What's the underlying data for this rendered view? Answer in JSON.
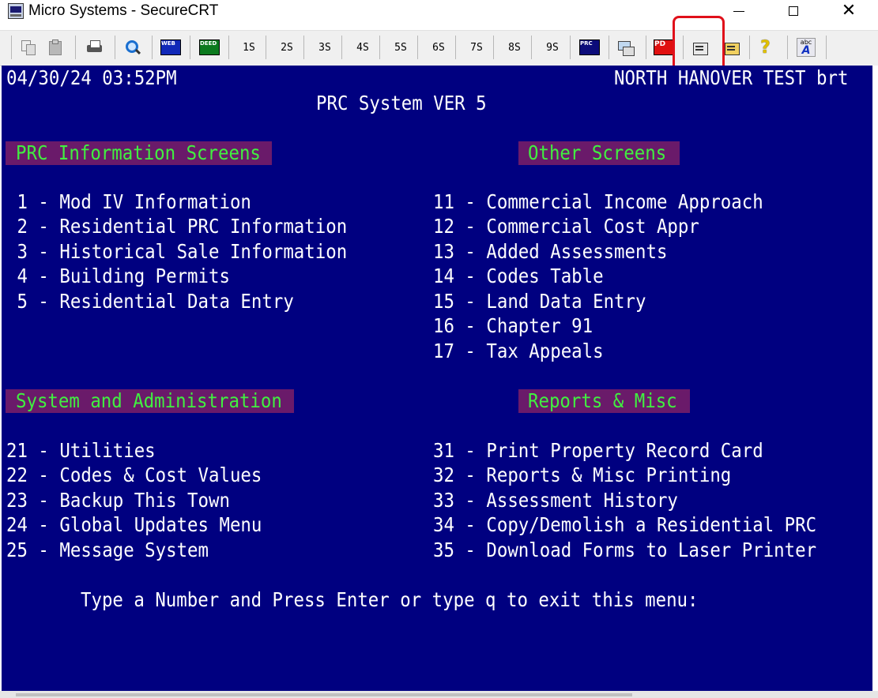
{
  "window": {
    "title": "Micro Systems - SecureCRT",
    "controls": {
      "minimize": "—",
      "maximize": "☐",
      "close": "✕"
    }
  },
  "toolbar": {
    "icons": [
      "copy-icon",
      "paste-icon",
      "print-icon",
      "find-icon",
      "web-icon",
      "deed-icon",
      "prc-icon",
      "sftp-icon",
      "pdf-icon",
      "session-options-icon",
      "global-options-icon",
      "help-icon",
      "spell-check-icon"
    ],
    "badges": {
      "web": "WEB",
      "deed": "DEED",
      "prc": "PRC",
      "pdf": "PD"
    },
    "sessions": [
      "1S",
      "2S",
      "3S",
      "4S",
      "5S",
      "6S",
      "7S",
      "8S",
      "9S"
    ],
    "help_glyph": "?",
    "abc_small": "abc",
    "abc_big": "A",
    "highlight_color": "#e0101a"
  },
  "terminal": {
    "background": "#000080",
    "datetime": "04/30/24 03:52PM",
    "town": "NORTH HANOVER TEST brt",
    "system_title": "PRC System VER 5",
    "sections": {
      "prc_info": "PRC Information Screens",
      "other": "Other Screens",
      "sysadmin": "System and Administration",
      "reports": "Reports & Misc"
    },
    "left_top": [
      " 1 - Mod IV Information",
      " 2 - Residential PRC Information",
      " 3 - Historical Sale Information",
      " 4 - Building Permits",
      " 5 - Residential Data Entry"
    ],
    "right_top": [
      "11 - Commercial Income Approach",
      "12 - Commercial Cost Appr",
      "13 - Added Assessments",
      "14 - Codes Table",
      "15 - Land Data Entry",
      "16 - Chapter 91",
      "17 - Tax Appeals"
    ],
    "left_bottom": [
      "21 - Utilities",
      "22 - Codes & Cost Values",
      "23 - Backup This Town",
      "24 - Global Updates Menu",
      "25 - Message System"
    ],
    "right_bottom": [
      "31 - Print Property Record Card",
      "32 - Reports & Misc Printing",
      "33 - Assessment History",
      "34 - Copy/Demolish a Residential PRC",
      "35 - Download Forms to Laser Printer"
    ],
    "prompt": "Type a Number and Press Enter or type q to exit this menu:"
  }
}
